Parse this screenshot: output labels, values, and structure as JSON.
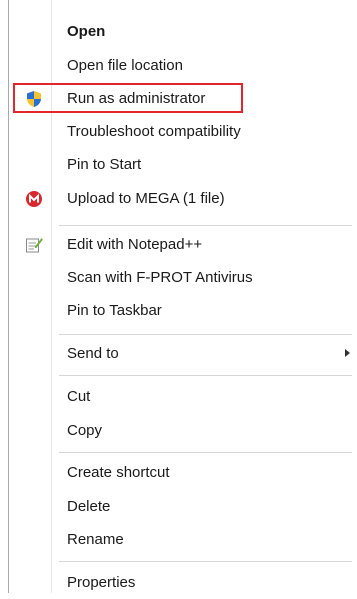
{
  "menu": {
    "items": [
      {
        "label": "Open"
      },
      {
        "label": "Open file location"
      },
      {
        "label": "Run as administrator",
        "icon": "uac-shield-icon"
      },
      {
        "label": "Troubleshoot compatibility"
      },
      {
        "label": "Pin to Start"
      },
      {
        "label": "Upload to MEGA (1 file)",
        "icon": "mega-icon"
      },
      {
        "label": "Edit with Notepad++",
        "icon": "notepad-plus-plus-icon"
      },
      {
        "label": "Scan with F-PROT Antivirus"
      },
      {
        "label": "Pin to Taskbar"
      },
      {
        "label": "Send to"
      },
      {
        "label": "Cut"
      },
      {
        "label": "Copy"
      },
      {
        "label": "Create shortcut"
      },
      {
        "label": "Delete"
      },
      {
        "label": "Rename"
      },
      {
        "label": "Properties"
      }
    ],
    "highlighted_item": "Run as administrator",
    "highlight_color": "#e3262d"
  }
}
